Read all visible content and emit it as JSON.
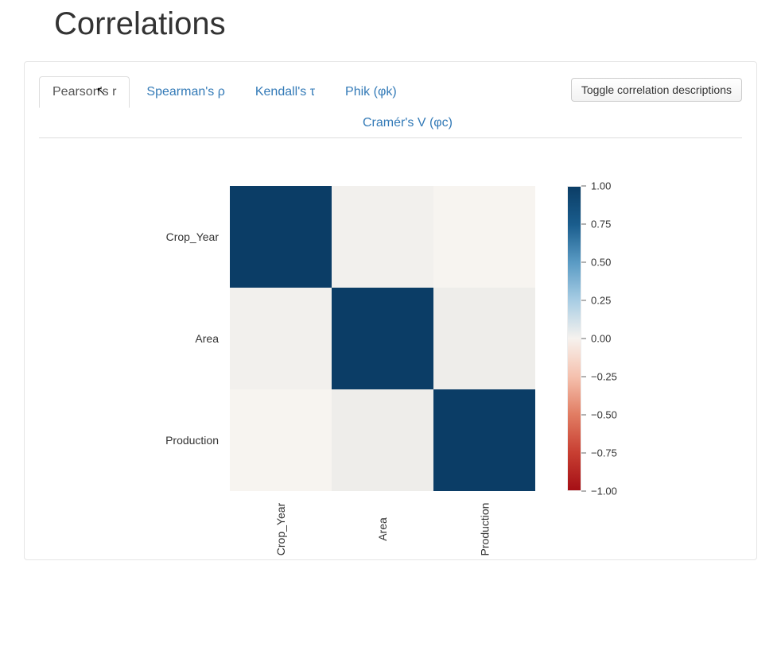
{
  "title": "Correlations",
  "toggle_button": "Toggle correlation descriptions",
  "tabs": [
    {
      "id": "pearson",
      "label": "Pearson's r",
      "active": true
    },
    {
      "id": "spearman",
      "label": "Spearman's ρ",
      "active": false
    },
    {
      "id": "kendall",
      "label": "Kendall's τ",
      "active": false
    },
    {
      "id": "phik",
      "label": "Phik (φk)",
      "active": false
    },
    {
      "id": "cramer",
      "label": "Cramér's V (φc)",
      "active": false
    }
  ],
  "chart_data": {
    "type": "heatmap",
    "title": "",
    "xlabel": "",
    "ylabel": "",
    "x_categories": [
      "Crop_Year",
      "Area",
      "Production"
    ],
    "y_categories": [
      "Crop_Year",
      "Area",
      "Production"
    ],
    "matrix": [
      [
        1.0,
        0.02,
        0.0
      ],
      [
        0.02,
        1.0,
        0.04
      ],
      [
        0.0,
        0.04,
        1.0
      ]
    ],
    "colorbar": {
      "min": -1.0,
      "max": 1.0,
      "ticks": [
        1.0,
        0.75,
        0.5,
        0.25,
        0.0,
        -0.25,
        -0.5,
        -0.75,
        -1.0
      ]
    }
  }
}
